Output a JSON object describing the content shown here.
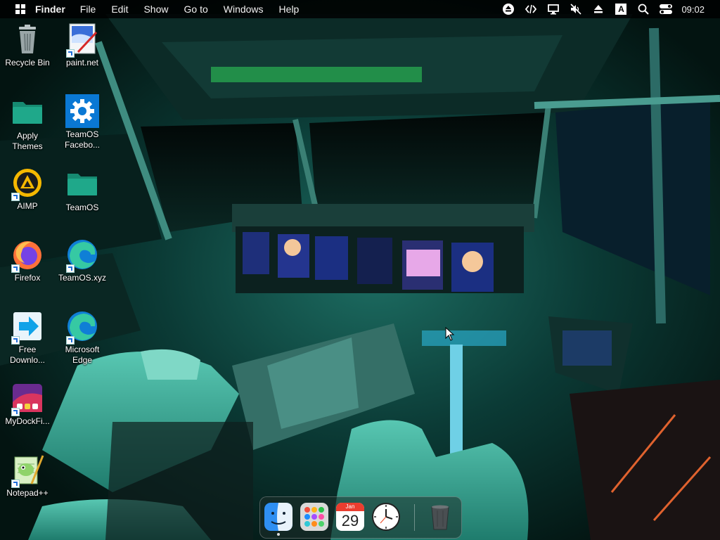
{
  "menubar": {
    "app_name": "Finder",
    "items": [
      "File",
      "Edit",
      "Show",
      "Go to",
      "Windows",
      "Help"
    ],
    "input_indicator": "A",
    "clock": "09:02"
  },
  "desktop": {
    "icons": [
      {
        "label": "Recycle Bin"
      },
      {
        "label": "paint.net"
      },
      {
        "label": "Apply Themes"
      },
      {
        "label": "TeamOS Facebo..."
      },
      {
        "label": "AIMP"
      },
      {
        "label": "TeamOS"
      },
      {
        "label": "Firefox"
      },
      {
        "label": "TeamOS.xyz"
      },
      {
        "label": "Free Downlo..."
      },
      {
        "label": "Microsoft Edge"
      },
      {
        "label": "MyDockFi..."
      },
      {
        "label": "Notepad++"
      }
    ]
  },
  "dock": {
    "calendar_month": "Jan",
    "calendar_day": "29"
  },
  "colors": {
    "menubar_bg": "#000000",
    "folder_teal": "#1fa88a",
    "teamos_blue": "#0a78d4",
    "aimp_yellow": "#f5b800"
  }
}
